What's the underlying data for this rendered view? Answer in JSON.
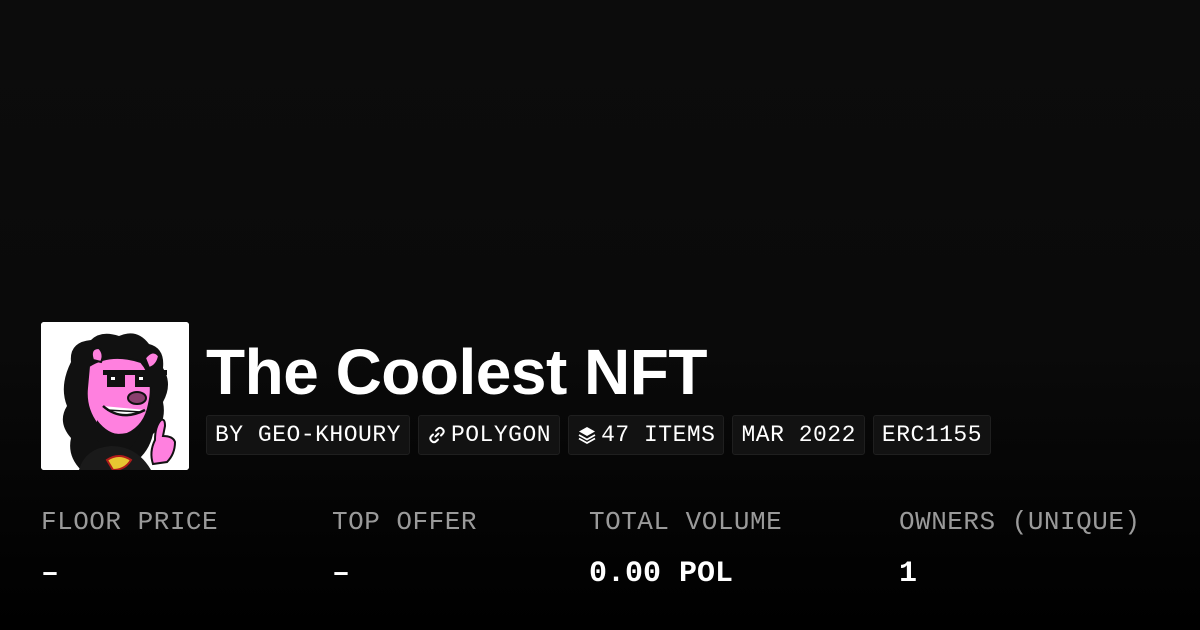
{
  "collection": {
    "title": "The Coolest NFT",
    "avatar_icon": "pink-lion-with-sunglasses-image"
  },
  "tags": {
    "creator": "BY GEO-KHOURY",
    "chain": "POLYGON",
    "chain_icon": "chain-link-icon",
    "items": "47 ITEMS",
    "items_icon": "layers-icon",
    "date": "MAR 2022",
    "standard": "ERC1155"
  },
  "stats": [
    {
      "label": "FLOOR PRICE",
      "value": "–"
    },
    {
      "label": "TOP OFFER",
      "value": "–"
    },
    {
      "label": "TOTAL VOLUME",
      "value": "0.00 POL"
    },
    {
      "label": "OWNERS (UNIQUE)",
      "value": "1"
    }
  ],
  "colors": {
    "background": "#0a0a0a",
    "text": "#ffffff",
    "muted_text": "#9a9a9a",
    "tag_background": "#121212",
    "avatar_pink": "#ff80df"
  }
}
